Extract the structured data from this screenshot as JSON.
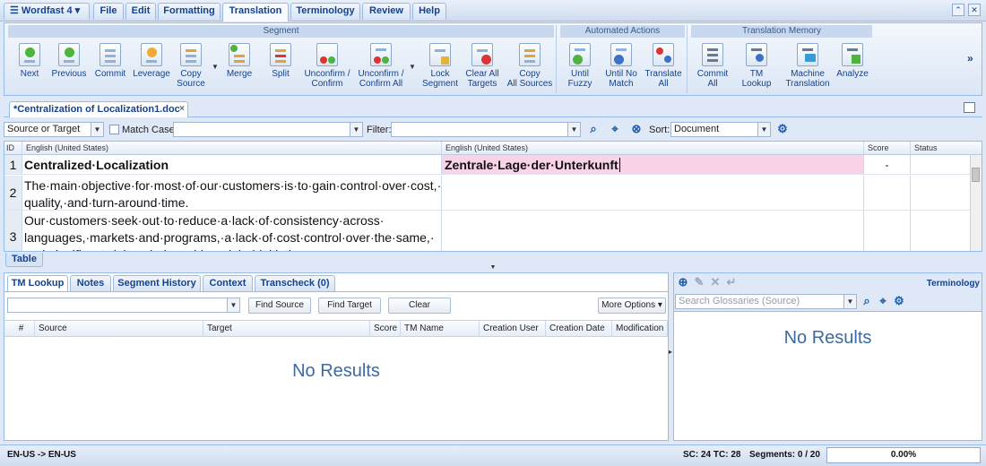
{
  "menu": {
    "app": "Wordfast 4",
    "tabs": [
      "File",
      "Edit",
      "Formatting",
      "Translation",
      "Terminology",
      "Review",
      "Help"
    ],
    "active_tab": "Translation"
  },
  "ribbon": {
    "groups": {
      "segment": "Segment",
      "automated": "Automated Actions",
      "tm": "Translation Memory"
    },
    "buttons": {
      "next": [
        "Next",
        ""
      ],
      "previous": [
        "Previous",
        ""
      ],
      "commit": [
        "Commit",
        ""
      ],
      "leverage": [
        "Leverage",
        ""
      ],
      "copy_source": [
        "Copy",
        "Source"
      ],
      "merge": [
        "Merge",
        ""
      ],
      "split": [
        "Split",
        ""
      ],
      "unconfirm": [
        "Unconfirm /",
        "Confirm"
      ],
      "unconfirm_all": [
        "Unconfirm /",
        "Confirm All"
      ],
      "lock_segment": [
        "Lock",
        "Segment"
      ],
      "clear_all_targets": [
        "Clear All",
        "Targets"
      ],
      "copy_all_sources": [
        "Copy",
        "All Sources"
      ],
      "until_fuzzy": [
        "Until",
        "Fuzzy"
      ],
      "until_no_match": [
        "Until No",
        "Match"
      ],
      "translate_all": [
        "Translate",
        "All"
      ],
      "commit_all": [
        "Commit",
        "All"
      ],
      "tm_lookup": [
        "TM Lookup",
        ""
      ],
      "machine_translation": [
        "Machine",
        "Translation"
      ],
      "analyze": [
        "Analyze",
        ""
      ]
    },
    "more": "»"
  },
  "document": {
    "tab_title": "*Centralization of Localization1.doc",
    "close": "×"
  },
  "search": {
    "scope": "Source or Target",
    "match_case": "Match Case",
    "filter_label": "Filter:",
    "sort_label": "Sort:",
    "sort_value": "Document"
  },
  "grid": {
    "headers": {
      "id": "ID",
      "source": "English (United States)",
      "target": "English (United States)",
      "score": "Score",
      "status": "Status"
    },
    "rows": [
      {
        "id": "1",
        "source": "Centralized·Localization",
        "target": "Zentrale·Lage·der·Unterkunft",
        "score": "-"
      },
      {
        "id": "2",
        "source": "The·main·objective·for·most·of·our·customers·is·to·gain·control·over·cost,· quality,·and·turn-around·time.",
        "target": "",
        "score": ""
      },
      {
        "id": "3",
        "source": "Our·customers·seek·out·to·reduce·a·lack·of·consistency·across· languages,·markets·and·programs,·a·lack·of·cost·control·over·the·same,· and·significant·delays·in·launching·global·initiatives.",
        "target": "",
        "score": ""
      }
    ]
  },
  "table_tab": "Table",
  "lower": {
    "tabs": [
      "TM Lookup",
      "Notes",
      "Segment History",
      "Context",
      "Transcheck (0)"
    ],
    "buttons": {
      "find_source": "Find Source",
      "find_target": "Find Target",
      "clear": "Clear",
      "more_options": "More Options"
    },
    "columns": [
      "#",
      "Source",
      "Target",
      "Score",
      "TM Name",
      "Creation User",
      "Creation Date",
      "Modification ..."
    ],
    "empty": "No Results"
  },
  "terminology": {
    "title": "Terminology",
    "search_placeholder": "Search Glossaries (Source)",
    "empty": "No Results"
  },
  "status": {
    "lang": "EN-US -> EN-US",
    "counts": "SC: 24 TC: 28",
    "segments": "Segments: 0 / 20",
    "progress": "0.00%"
  },
  "colors": {
    "accent": "#15428b",
    "active_target_bg": "#fbd3e9"
  }
}
